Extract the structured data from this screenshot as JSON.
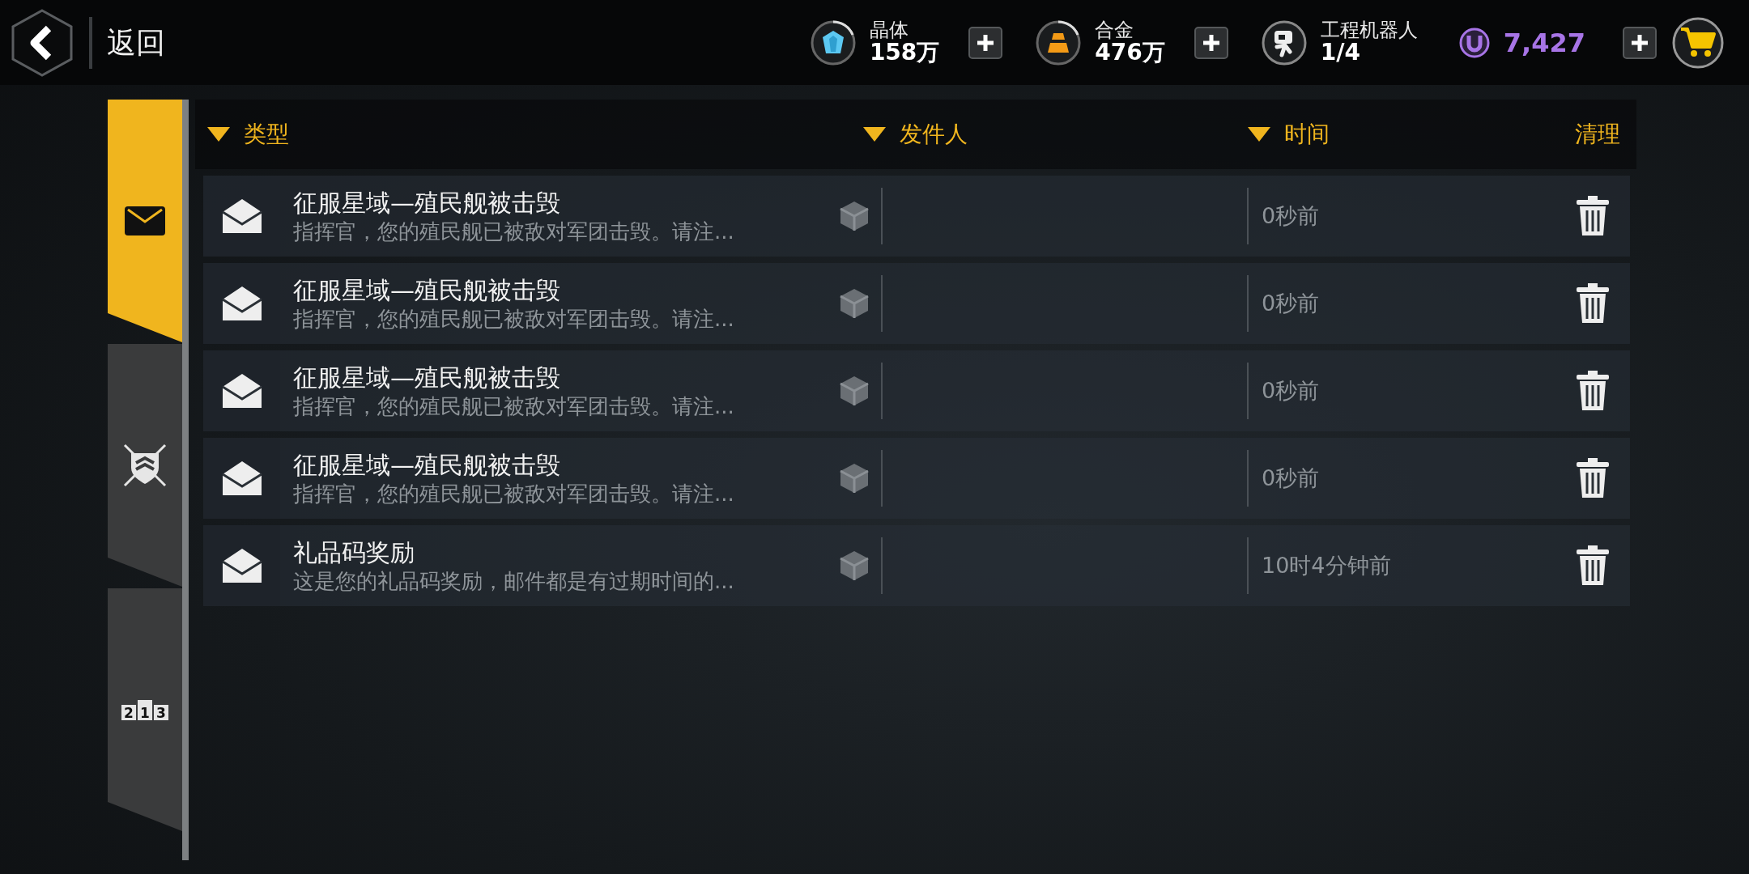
{
  "header": {
    "back_label": "返回"
  },
  "resources": [
    {
      "kind": "crystal",
      "label": "晶体",
      "value": "158万",
      "addable": true
    },
    {
      "kind": "alloy",
      "label": "合金",
      "value": "476万",
      "addable": true
    },
    {
      "kind": "robot",
      "label": "工程机器人",
      "value": "1/4",
      "addable": false
    },
    {
      "kind": "premium",
      "value": "7,427",
      "addable": true
    }
  ],
  "tabs": [
    {
      "kind": "mail",
      "selected": true
    },
    {
      "kind": "guild",
      "selected": false
    },
    {
      "kind": "ranking",
      "selected": false,
      "digits": [
        "2",
        "1",
        "3"
      ]
    }
  ],
  "columns": [
    {
      "label": "类型",
      "sortable": true
    },
    {
      "label": "发件人",
      "sortable": true
    },
    {
      "label": "时间",
      "sortable": true
    },
    {
      "label": "清理",
      "sortable": false
    }
  ],
  "mails": [
    {
      "title": "征服星域—殖民舰被击毁",
      "preview": "指挥官，您的殖民舰已被敌对军团击毁。请注...",
      "time": "0秒前",
      "opened": true
    },
    {
      "title": "征服星域—殖民舰被击毁",
      "preview": "指挥官，您的殖民舰已被敌对军团击毁。请注...",
      "time": "0秒前",
      "opened": true
    },
    {
      "title": "征服星域—殖民舰被击毁",
      "preview": "指挥官，您的殖民舰已被敌对军团击毁。请注...",
      "time": "0秒前",
      "opened": true
    },
    {
      "title": "征服星域—殖民舰被击毁",
      "preview": "指挥官，您的殖民舰已被敌对军团击毁。请注...",
      "time": "0秒前",
      "opened": true
    },
    {
      "title": "礼品码奖励",
      "preview": "这是您的礼品码奖励，邮件都是有过期时间的...",
      "time": "10时4分钟前",
      "opened": true
    }
  ]
}
